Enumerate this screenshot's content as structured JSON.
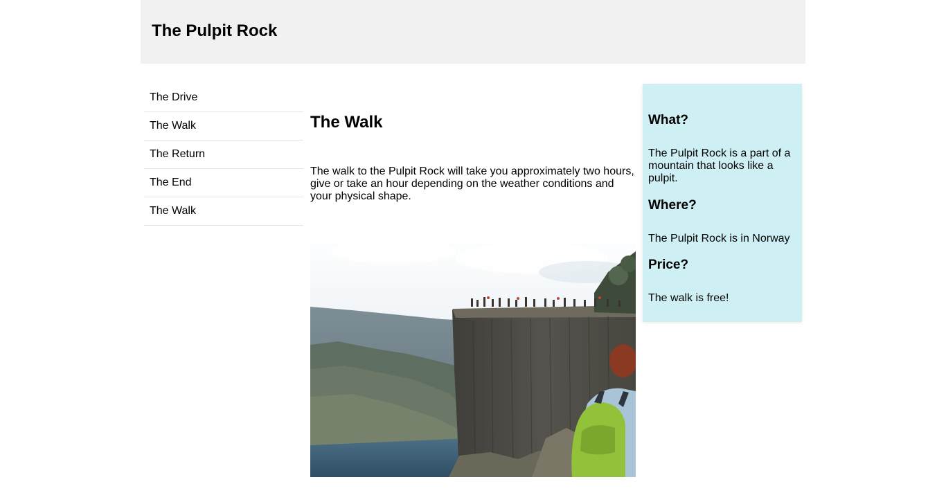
{
  "header": {
    "title": "The Pulpit Rock"
  },
  "menu": {
    "items": [
      {
        "label": "The Drive"
      },
      {
        "label": "The Walk"
      },
      {
        "label": "The Return"
      },
      {
        "label": "The End"
      },
      {
        "label": "The Walk"
      }
    ]
  },
  "main": {
    "heading": "The Walk",
    "paragraph": "The walk to the Pulpit Rock will take you approximately two hours, give or take an hour depending on the weather conditions and your physical shape.",
    "image_icon": "photo-pulpit-rock"
  },
  "aside": {
    "sections": [
      {
        "heading": "What?",
        "text": "The Pulpit Rock is a part of a mountain that looks like a pulpit."
      },
      {
        "heading": "Where?",
        "text": "The Pulpit Rock is in Norway"
      },
      {
        "heading": "Price?",
        "text": "The walk is free!"
      }
    ]
  },
  "colors": {
    "header_background": "#f1f1f1",
    "aside_background": "#cef0f5",
    "menu_divider": "#e5e5e5"
  }
}
